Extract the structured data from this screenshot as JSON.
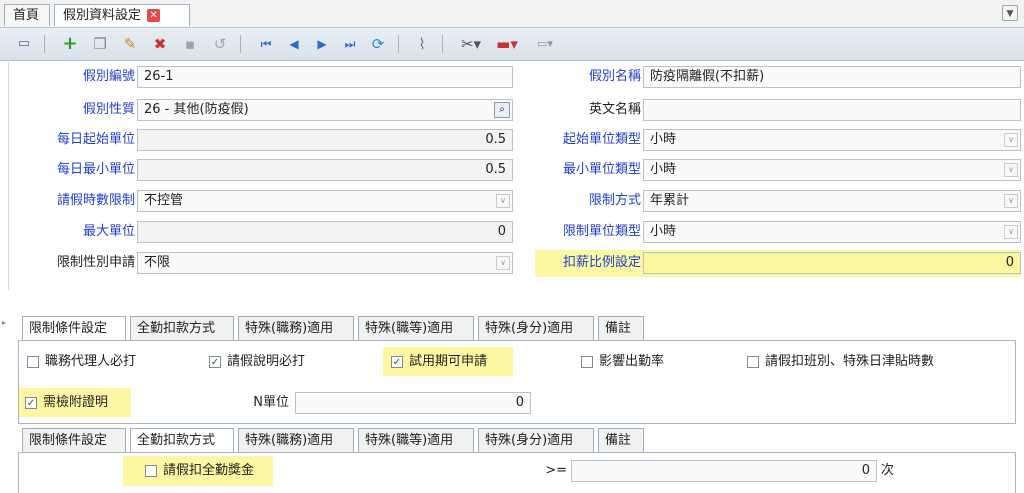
{
  "top_tabs": [
    "首頁",
    "假別資料設定"
  ],
  "toolbar": {
    "icons": [
      "view-icon",
      "add-icon",
      "copy-icon",
      "edit-icon",
      "delete-icon",
      "save-icon",
      "undo-icon",
      "first-icon",
      "prev-icon",
      "next-icon",
      "last-icon",
      "refresh-icon",
      "attach-icon",
      "tools-icon",
      "toolbox-icon",
      "more-icon"
    ]
  },
  "form": {
    "leave_code_label": "假別編號",
    "leave_code_value": "26-1",
    "leave_name_label": "假別名稱",
    "leave_name_value": "防疫隔離假(不扣薪)",
    "leave_nature_label": "假別性質",
    "leave_nature_value": "26 - 其他(防疫假)",
    "english_name_label": "英文名稱",
    "english_name_value": "",
    "daily_start_unit_label": "每日起始單位",
    "daily_start_unit_value": "0.5",
    "start_unit_type_label": "起始單位類型",
    "start_unit_type_value": "小時",
    "daily_min_unit_label": "每日最小單位",
    "daily_min_unit_value": "0.5",
    "min_unit_type_label": "最小單位類型",
    "min_unit_type_value": "小時",
    "hours_limit_label": "請假時數限制",
    "hours_limit_value": "不控管",
    "limit_method_label": "限制方式",
    "limit_method_value": "年累計",
    "max_unit_label": "最大單位",
    "max_unit_value": "0",
    "limit_unit_type_label": "限制單位類型",
    "limit_unit_type_value": "小時",
    "gender_limit_label": "限制性別申請",
    "gender_limit_value": "不限",
    "deduct_ratio_label": "扣薪比例設定",
    "deduct_ratio_value": "0"
  },
  "subtabs": [
    "限制條件設定",
    "全勤扣款方式",
    "特殊(職務)適用",
    "特殊(職等)適用",
    "特殊(身分)適用",
    "備註"
  ],
  "panel1": {
    "cb_agent": "職務代理人必打",
    "cb_reason": "請假說明必打",
    "cb_probation": "試用期可申請",
    "cb_attendance": "影響出勤率",
    "cb_shift": "請假扣班別、特殊日津貼時數",
    "cb_proof": "需檢附證明",
    "n_unit_label": "N單位",
    "n_unit_value": "0",
    "checked_mark": "✓"
  },
  "panel2": {
    "cb_deduct_bonus": "請假扣全勤獎金",
    "ge_label": ">=",
    "ge_value": "0",
    "times_label": "次"
  }
}
